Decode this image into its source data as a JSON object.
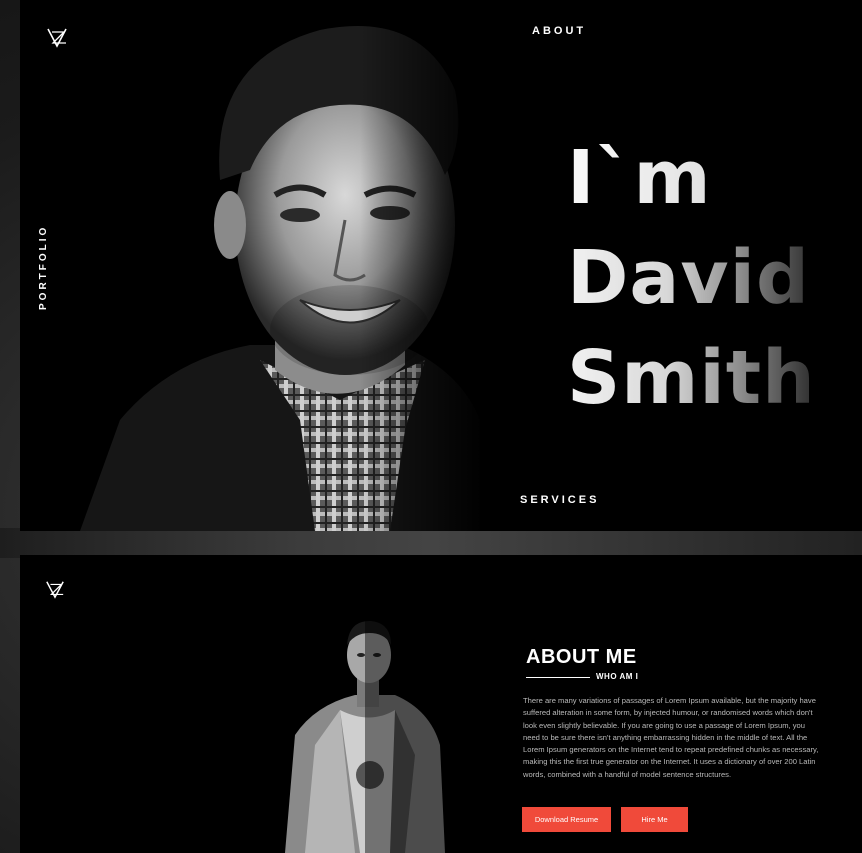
{
  "hero": {
    "logo": "VZ-monogram-icon",
    "nav": {
      "about": "ABOUT",
      "services": "SERVICES",
      "portfolio": "PORTFOLIO"
    },
    "title": {
      "line1": "I`m",
      "line2": "David",
      "line3": "Smith"
    }
  },
  "about": {
    "logo": "VZ-monogram-icon",
    "heading": "ABOUT ME",
    "subheading": "WHO AM I",
    "body": "There are many variations of passages of Lorem Ipsum available, but the majority have suffered alteration in some form, by injected humour, or randomised words which don't look even slightly believable. If you are going to use a passage of Lorem Ipsum, you need to be sure there isn't anything embarrassing hidden in the middle of text. All the Lorem Ipsum generators on the Internet tend to repeat predefined chunks as necessary, making this the first true generator on the Internet. It uses a dictionary of over 200 Latin words, combined with a handful of model sentence structures.",
    "buttons": {
      "download_resume": "Download Resume",
      "hire_me": "Hire Me"
    }
  },
  "colors": {
    "accent": "#f04a3a",
    "background": "#000000",
    "text": "#ffffff"
  }
}
